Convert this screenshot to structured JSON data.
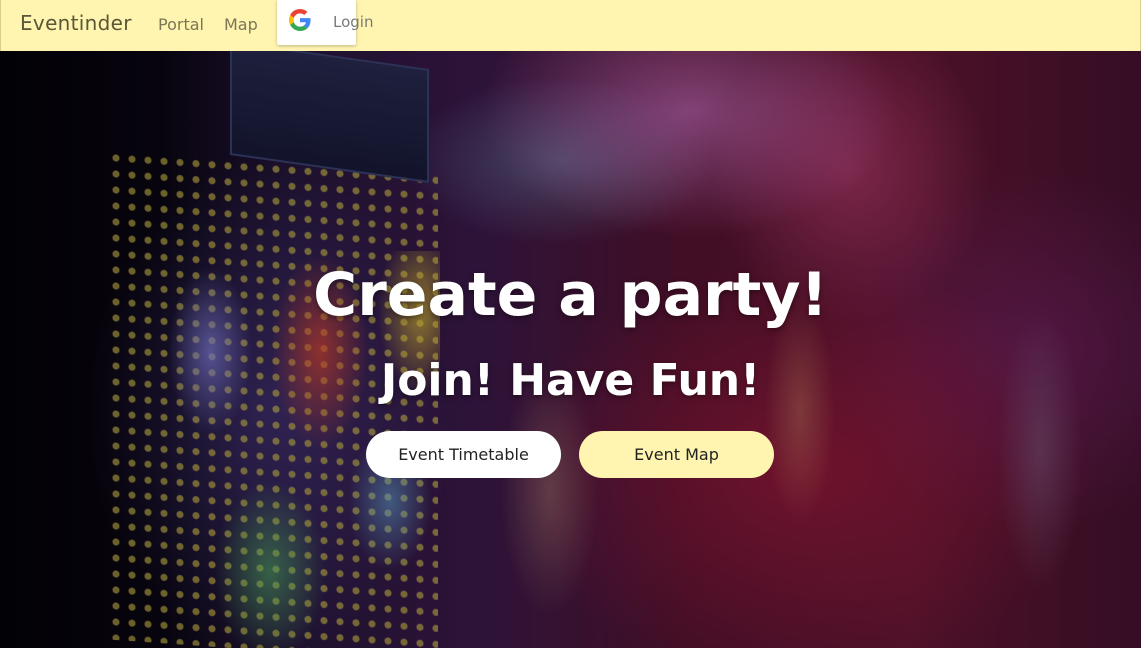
{
  "navbar": {
    "brand": "Eventinder",
    "links": [
      {
        "label": "Portal"
      },
      {
        "label": "Map"
      }
    ],
    "login": {
      "label": "Login",
      "icon": "google-icon"
    }
  },
  "hero": {
    "title": "Create a party!",
    "subtitle": "Join! Have Fun!",
    "buttons": {
      "timetable": "Event Timetable",
      "map": "Event Map"
    }
  },
  "colors": {
    "navbar_bg": "#fff4b0",
    "map_button_bg": "#fff4b0",
    "timetable_button_bg": "#ffffff",
    "hero_text": "#ffffff"
  }
}
